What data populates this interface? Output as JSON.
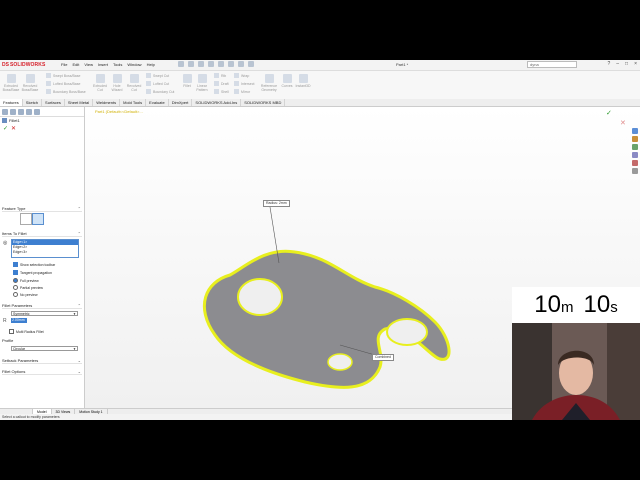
{
  "app": {
    "logo_brand": "DS",
    "logo_text": "SOLIDWORKS",
    "doc_title": "Part1 *",
    "search_placeholder": "dyna",
    "window_buttons": [
      "?",
      "–",
      "□",
      "×"
    ]
  },
  "menu": [
    "File",
    "Edit",
    "View",
    "Insert",
    "Tools",
    "Window",
    "Help"
  ],
  "ribbon": {
    "extruded_boss": "Extruded Boss/Base",
    "revolved_boss": "Revolved Boss/Base",
    "swept_boss": "Swept Boss/Base",
    "lofted_boss": "Lofted Boss/Base",
    "boundary_boss": "Boundary Boss/Base",
    "extruded_cut": "Extruded Cut",
    "hole_wizard": "Hole Wizard",
    "revolved_cut": "Revolved Cut",
    "swept_cut": "Swept Cut",
    "lofted_cut": "Lofted Cut",
    "boundary_cut": "Boundary Cut",
    "fillet": "Fillet",
    "linear_pattern": "Linear Pattern",
    "rib": "Rib",
    "draft": "Draft",
    "shell": "Shell",
    "wrap": "Wrap",
    "intersect": "Intersect",
    "mirror": "Mirror",
    "reference_geometry": "Reference Geometry",
    "curves": "Curves",
    "instant3d": "Instant3D"
  },
  "cm_tabs": [
    "Features",
    "Sketch",
    "Surfaces",
    "Sheet Metal",
    "Weldments",
    "Mold Tools",
    "Evaluate",
    "DimXpert",
    "SOLIDWORKS Add-Ins",
    "SOLIDWORKS MBD"
  ],
  "property_manager": {
    "title": "Fillet1",
    "ok": "✓",
    "cancel": "✕",
    "section_feature_type": "Feature Type",
    "section_items": "Items To Fillet",
    "edges": [
      "Edge<1>",
      "Edge<2>",
      "Edge<3>"
    ],
    "show_selection_toolbar": "Show selection toolbar",
    "tangent_propagation": "Tangent propagation",
    "full_preview": "Full preview",
    "partial_preview": "Partial preview",
    "no_preview": "No preview",
    "section_fillet_parameters": "Fillet Parameters",
    "symmetric": "Symmetric",
    "radius_value": "2.00mm",
    "multi_radius": "Multi Radius Fillet",
    "profile_label": "Profile",
    "profile_value": "Circular",
    "section_setback": "Setback Parameters",
    "section_fillet_options": "Fillet Options"
  },
  "viewport": {
    "breadcrumb": "Part1 (Default<<Default>...",
    "radius_callout": "Radius: 2mm",
    "combined_callout": "Combined"
  },
  "bottom_tabs": [
    "Model",
    "3D Views",
    "Motion Study 1"
  ],
  "status": "Select a callout to modify parameters",
  "timer": {
    "minutes": "10",
    "min_unit": "m",
    "seconds": "10",
    "sec_unit": "s"
  },
  "colors": {
    "preview_yellow": "#e8ef1e",
    "part_gray": "#8c8c90",
    "accent_blue": "#3d7fd0",
    "brand_red": "#d6202a"
  }
}
